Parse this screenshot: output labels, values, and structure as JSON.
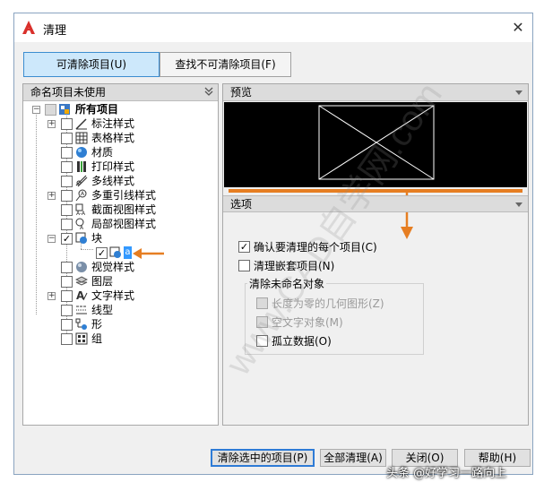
{
  "window": {
    "title": "清理",
    "close_glyph": "✕"
  },
  "tabs": [
    {
      "label": "可清除项目(U)",
      "active": true
    },
    {
      "label": "查找不可清除项目(F)",
      "active": false
    }
  ],
  "left_panel": {
    "header": "命名项目未使用",
    "tree": [
      {
        "label": "所有项目",
        "icon": "all-items-icon",
        "checked": "partial",
        "expandable": true,
        "bold": true
      },
      {
        "label": "标注样式",
        "icon": "dimension-style-icon",
        "checked": false,
        "expandable": true
      },
      {
        "label": "表格样式",
        "icon": "table-style-icon",
        "checked": false,
        "expandable": false
      },
      {
        "label": "材质",
        "icon": "material-icon",
        "checked": false,
        "expandable": false
      },
      {
        "label": "打印样式",
        "icon": "plot-style-icon",
        "checked": false,
        "expandable": false
      },
      {
        "label": "多线样式",
        "icon": "multiline-style-icon",
        "checked": false,
        "expandable": false
      },
      {
        "label": "多重引线样式",
        "icon": "mleader-style-icon",
        "checked": false,
        "expandable": true
      },
      {
        "label": "截面视图样式",
        "icon": "section-view-style-icon",
        "checked": false,
        "expandable": false
      },
      {
        "label": "局部视图样式",
        "icon": "detail-view-style-icon",
        "checked": false,
        "expandable": false
      },
      {
        "label": "块",
        "icon": "block-icon",
        "checked": true,
        "expandable": true
      },
      {
        "label": "",
        "icon": "block-item-icon",
        "checked": true,
        "child": true,
        "selected_glyph": "a"
      },
      {
        "label": "视觉样式",
        "icon": "visual-style-icon",
        "checked": false,
        "expandable": false
      },
      {
        "label": "图层",
        "icon": "layer-icon",
        "checked": false,
        "expandable": false
      },
      {
        "label": "文字样式",
        "icon": "text-style-icon",
        "checked": false,
        "expandable": true
      },
      {
        "label": "线型",
        "icon": "linetype-icon",
        "checked": false,
        "expandable": false
      },
      {
        "label": "形",
        "icon": "shape-icon",
        "checked": false,
        "expandable": false
      },
      {
        "label": "组",
        "icon": "group-icon",
        "checked": false,
        "expandable": false
      }
    ]
  },
  "right_panel": {
    "preview_header": "预览",
    "options_header": "选项",
    "options": {
      "confirm_each": {
        "label": "确认要清理的每个项目(C)",
        "checked": true
      },
      "purge_nested": {
        "label": "清理嵌套项目(N)",
        "checked": false
      },
      "unnamed_group": "清除未命名对象",
      "zero_length": {
        "label": "长度为零的几何图形(Z)",
        "checked": false,
        "disabled": true
      },
      "empty_text": {
        "label": "空文字对象(M)",
        "checked": false,
        "disabled": true
      },
      "orphaned_data": {
        "label": "孤立数据(O)",
        "checked": false
      }
    }
  },
  "buttons": {
    "purge_selected": "清除选中的项目(P)",
    "purge_all": "全部清理(A)",
    "close": "关闭(O)",
    "help": "帮助(H)"
  },
  "overlay": {
    "watermark": "www.CAD自学网.com",
    "credit": "头条 @好学习一路向上"
  },
  "colors": {
    "accent_arrow": "#e67e22",
    "active_tab": "#cde8fb",
    "preview_bg": "#000000"
  }
}
